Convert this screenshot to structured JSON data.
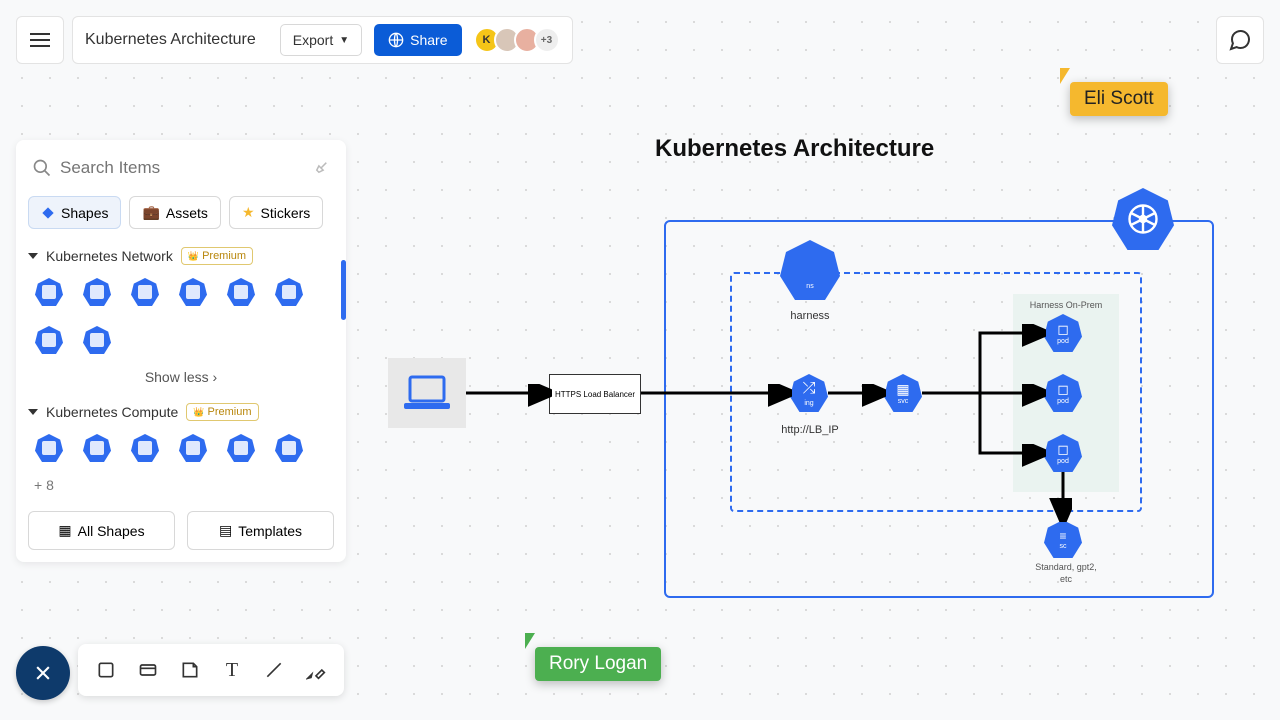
{
  "docTitle": "Kubernetes Architecture",
  "export": "Export",
  "share": "Share",
  "avatarK": "K",
  "avatarPlus": "+3",
  "searchPlaceholder": "Search Items",
  "tabs": {
    "shapes": "Shapes",
    "assets": "Assets",
    "stickers": "Stickers"
  },
  "sections": {
    "network": "Kubernetes Network",
    "compute": "Kubernetes Compute"
  },
  "premium": "Premium",
  "showLess": "Show less  ›",
  "moreCount": "+ 8",
  "allShapes": "All Shapes",
  "templates": "Templates",
  "diagramTitle": "Kubernetes Architecture",
  "cursors": {
    "eli": "Eli Scott",
    "rory": "Rory Logan"
  },
  "diagram": {
    "lb": "HTTPS Load Balancer",
    "ns": "ns",
    "nsLabel": "harness",
    "ing": "ing",
    "ingLabel": "http://LB_IP",
    "svc": "svc",
    "pod": "pod",
    "onprem": "Harness On-Prem",
    "sc": "sc",
    "scLabel": "Standard, gpt2, etc"
  }
}
